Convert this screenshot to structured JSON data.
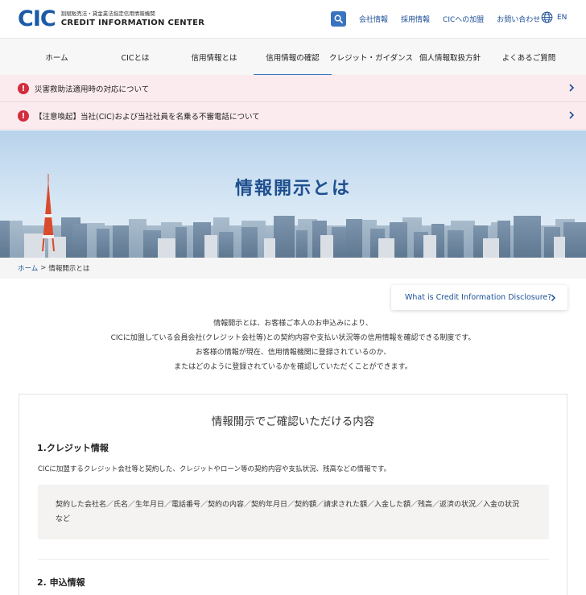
{
  "header": {
    "logo_mark": "CIC",
    "logo_sub": "割賦販売法・貸金業法指定信用情報機関",
    "logo_main": "CREDIT INFORMATION CENTER",
    "util_nav": [
      "会社情報",
      "採用情報",
      "CICへの加盟",
      "お問い合わせ"
    ],
    "lang_label": "EN",
    "accent_color": "#3a73c0"
  },
  "gnav": {
    "items": [
      "ホーム",
      "CICとは",
      "信用情報とは",
      "信用情報の確認",
      "クレジット・ガイダンス",
      "個人情報取扱方針",
      "よくあるご質問"
    ],
    "active_index": 3
  },
  "alerts": [
    {
      "icon": "exclamation-icon",
      "text": "災害救助法適用時の対応について"
    },
    {
      "icon": "exclamation-icon",
      "text": "【注意喚起】当社(CIC)および当社社員を名乗る不審電話について"
    }
  ],
  "hero": {
    "title": "情報開示とは"
  },
  "breadcrumb": {
    "home": "ホーム",
    "separator": ">",
    "current": "情報開示とは"
  },
  "english_link": {
    "label": "What is Credit Information Disclosure?"
  },
  "intro": {
    "lines": [
      "情報開示とは、お客様ご本人のお申込みにより、",
      "CICに加盟している会員会社(クレジット会社等)との契約内容や支払い状況等の信用情報を確認できる制度です。",
      "お客様の情報が現在、信用情報機関に登録されているのか、",
      "またはどのように登録されているかを確認していただくことができます。"
    ]
  },
  "card": {
    "title": "情報開示でご確認いただける内容",
    "section1": {
      "title": "1.クレジット情報",
      "desc": "CICに加盟するクレジット会社等と契約した、クレジットやローン等の契約内容や支払状況、残高などの情報です。",
      "items_line1": "契約した会社名／氏名／生年月日／電話番号／契約の内容／契約年月日／契約額／請求された額／入金した額／残高／返済の状況／入金の状況",
      "items_line2": "など"
    },
    "section2": {
      "title": "2. 申込情報"
    }
  }
}
